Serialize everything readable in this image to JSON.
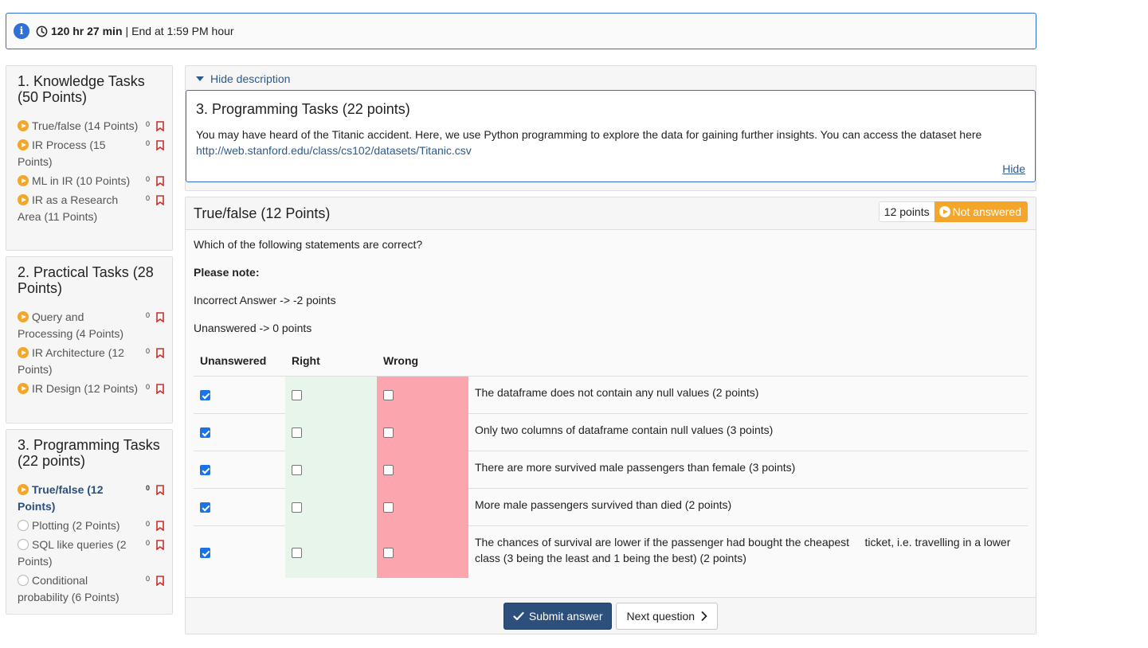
{
  "timer": {
    "remaining": "120 hr 27 min",
    "separator": "|",
    "end_text": "End at 1:59 PM hour"
  },
  "sidebar": {
    "sections": [
      {
        "title": "1. Knowledge Tasks (50 Points)",
        "items": [
          {
            "label": "True/false (14 Points)",
            "count": "0",
            "status": "in-progress"
          },
          {
            "label": "IR Process (15 Points)",
            "count": "0",
            "status": "in-progress"
          },
          {
            "label": "ML in IR (10 Points)",
            "count": "0",
            "status": "in-progress"
          },
          {
            "label": "IR as a Research Area (11 Points)",
            "count": "0",
            "status": "in-progress"
          }
        ]
      },
      {
        "title": "2. Practical Tasks (28 Points)",
        "items": [
          {
            "label": "Query and Processing (4 Points)",
            "count": "0",
            "status": "in-progress"
          },
          {
            "label": "IR Architecture (12 Points)",
            "count": "0",
            "status": "in-progress"
          },
          {
            "label": "IR Design (12 Points)",
            "count": "0",
            "status": "in-progress"
          }
        ]
      },
      {
        "title": "3. Programming Tasks (22 points)",
        "items": [
          {
            "label": "True/false (12 Points)",
            "count": "0",
            "status": "in-progress",
            "active": true
          },
          {
            "label": "Plotting (2 Points)",
            "count": "0",
            "status": "not-started"
          },
          {
            "label": "SQL like queries (2 Points)",
            "count": "0",
            "status": "not-started"
          },
          {
            "label": "Conditional probability (6 Points)",
            "count": "0",
            "status": "not-started"
          }
        ]
      }
    ]
  },
  "description": {
    "toggle_label": "Hide description",
    "title": "3. Programming Tasks (22 points)",
    "text": "You may have heard of the Titanic accident. Here, we use Python programming to explore the data for gaining further insights. You can access the dataset here",
    "link": "http://web.stanford.edu/class/cs102/datasets/Titanic.csv",
    "hide_label": "Hide"
  },
  "question": {
    "title": "True/false (12 Points)",
    "points_badge": "12 points",
    "status_badge": "Not answered",
    "prompt": "Which of the following statements are correct?",
    "note_label": "Please note:",
    "incorrect_rule": "Incorrect Answer -> -2 points",
    "unanswered_rule": "Unanswered -> 0 points",
    "columns": {
      "unanswered": "Unanswered",
      "right": "Right",
      "wrong": "Wrong"
    },
    "statements": [
      {
        "text": "The dataframe does not contain any null values  (2 points)",
        "unanswered": true,
        "right": false,
        "wrong": false
      },
      {
        "text": "Only two columns of dataframe contain null values  (3 points)",
        "unanswered": true,
        "right": false,
        "wrong": false
      },
      {
        "text": "There are more survived male passengers than female  (3 points)",
        "unanswered": true,
        "right": false,
        "wrong": false
      },
      {
        "text": "More male passengers survived than died  (2 points)",
        "unanswered": true,
        "right": false,
        "wrong": false
      },
      {
        "text": "The chances of survival are lower if the passenger had bought the cheapest     ticket, i.e. travelling in a lower class (3 being the least and 1 being the best) (2 points)",
        "unanswered": true,
        "right": false,
        "wrong": false
      }
    ],
    "submit_label": "Submit answer",
    "next_label": "Next question"
  },
  "colors": {
    "accent": "#2f6fd6",
    "in_progress": "#f4a62a",
    "right_col": "#e8f5ea",
    "wrong_col": "#fba5ae",
    "submit_bg": "#2c4f7c",
    "flag": "#c9302c"
  }
}
